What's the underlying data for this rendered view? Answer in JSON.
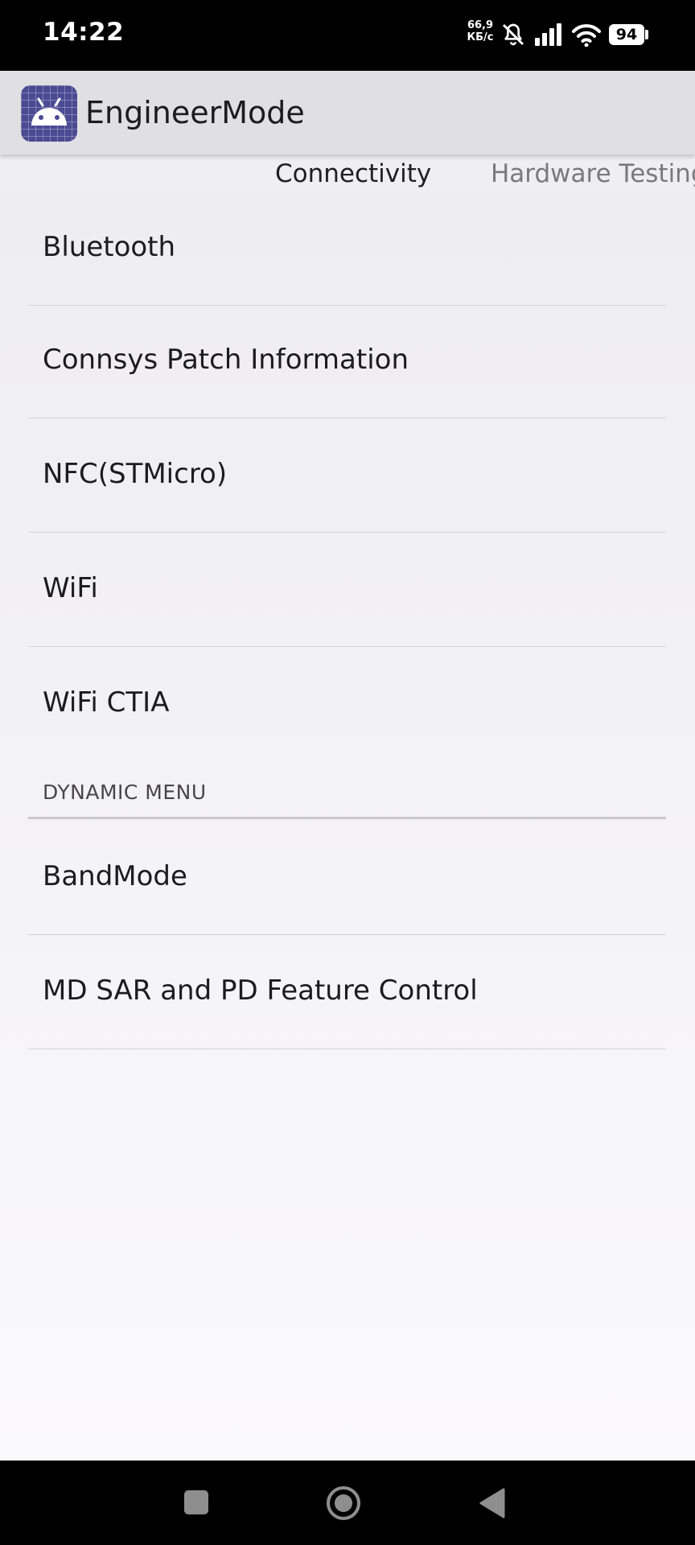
{
  "status_bar": {
    "time": "14:22",
    "net_speed_value": "66,9",
    "net_speed_unit": "КБ/с",
    "battery": "94",
    "icons": [
      "mute-notifications-icon",
      "cellular-signal-icon",
      "wifi-icon",
      "battery-icon"
    ]
  },
  "app_bar": {
    "icon": "android-app-icon",
    "title": "EngineerMode"
  },
  "tabs": [
    {
      "label": "Connectivity",
      "selected": true
    },
    {
      "label": "Hardware Testing",
      "selected": false
    }
  ],
  "list": {
    "items": [
      {
        "label": "Bluetooth"
      },
      {
        "label": "Connsys Patch Information"
      },
      {
        "label": "NFC(STMicro)"
      },
      {
        "label": "WiFi"
      },
      {
        "label": "WiFi CTIA"
      }
    ],
    "section_header": "DYNAMIC MENU",
    "dynamic_items": [
      {
        "label": "BandMode"
      },
      {
        "label": "MD SAR and PD Feature Control"
      }
    ]
  },
  "nav_bar": {
    "buttons": [
      "recents-button",
      "home-button",
      "back-button"
    ]
  },
  "colors": {
    "status_bar": "#000000",
    "app_bar": "#e0dfe3",
    "app_icon": "#4b4b94",
    "background": "#efeef1",
    "tab_active": "#1f1f1f",
    "tab_inactive": "#7a7a7a"
  }
}
